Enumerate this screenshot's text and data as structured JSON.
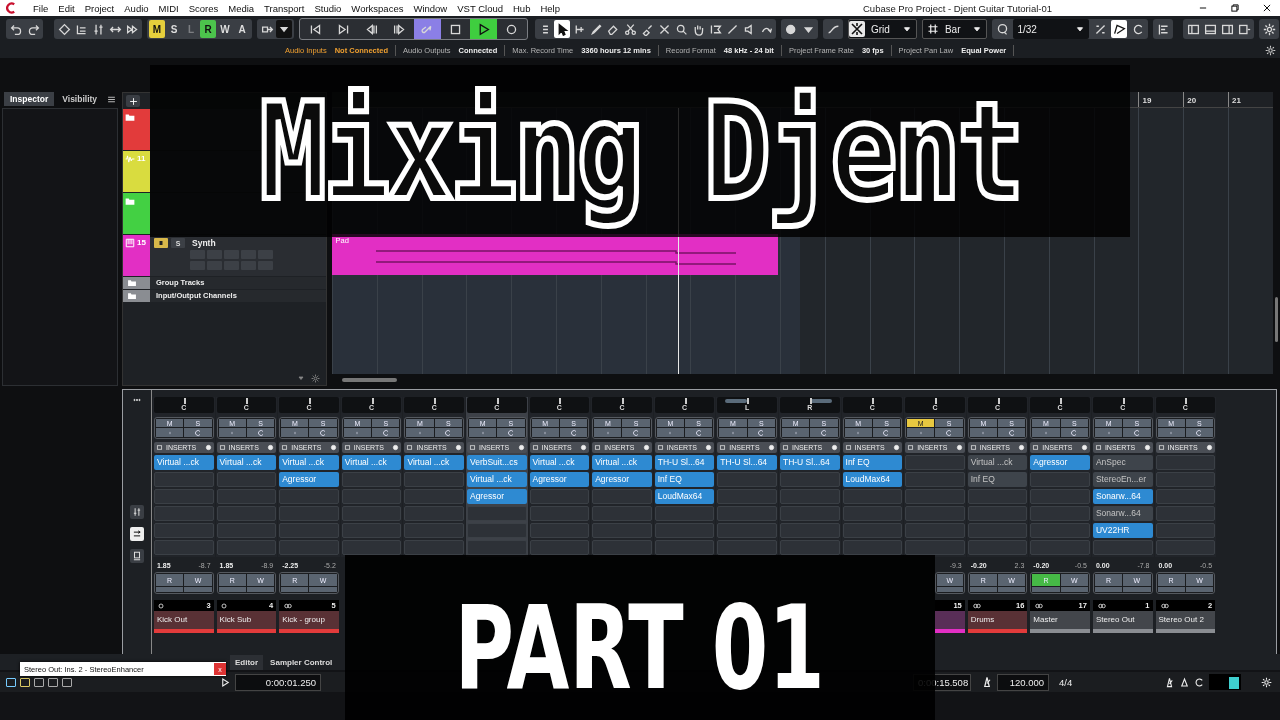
{
  "window": {
    "title": "Cubase Pro Project - Djent Guitar Tutorial-01"
  },
  "menu": [
    "File",
    "Edit",
    "Project",
    "Audio",
    "MIDI",
    "Scores",
    "Media",
    "Transport",
    "Studio",
    "Workspaces",
    "Window",
    "VST Cloud",
    "Hub",
    "Help"
  ],
  "toolbar": {
    "automation_modes": [
      {
        "label": "M",
        "on": true,
        "disabled": false,
        "color": "#e6cf3c"
      },
      {
        "label": "S",
        "on": false,
        "disabled": false
      },
      {
        "label": "L",
        "on": false,
        "disabled": true
      },
      {
        "label": "R",
        "on": true,
        "disabled": false,
        "color": "#4cc34c"
      },
      {
        "label": "W",
        "on": false,
        "disabled": false
      },
      {
        "label": "A",
        "on": false,
        "disabled": false
      }
    ],
    "cycle_on": true,
    "play_on": true,
    "snap_type": "Grid",
    "grid_type": "Bar",
    "quantize": "1/32"
  },
  "status_line": [
    {
      "label": "Audio Inputs",
      "value": "Not Connected",
      "warning": true
    },
    {
      "label": "Audio Outputs",
      "value": "Connected",
      "warning": false
    },
    {
      "label": "Max. Record Time",
      "value": "3360 hours 12 mins",
      "warning": false
    },
    {
      "label": "Record Format",
      "value": "48 kHz - 24 bit",
      "warning": false
    },
    {
      "label": "Project Frame Rate",
      "value": "30 fps",
      "warning": false
    },
    {
      "label": "Project Pan Law",
      "value": "Equal Power",
      "warning": false
    }
  ],
  "left_zone": {
    "tabs": [
      {
        "label": "Inspector",
        "selected": true
      },
      {
        "label": "Visibility",
        "selected": false
      }
    ]
  },
  "tracks": [
    {
      "kind": "folder",
      "color": "#e23b3b"
    },
    {
      "kind": "audio",
      "number": "11",
      "color": "#d9dc3f"
    },
    {
      "kind": "folder",
      "color": "#43d043"
    },
    {
      "kind": "instrument",
      "name": "Synth",
      "number": "15",
      "color": "#e22fc4",
      "mute_on": true,
      "solo_label": "S",
      "event": "Pad"
    },
    {
      "kind": "plain",
      "name": "Group Tracks"
    },
    {
      "kind": "plain",
      "name": "Input/Output Channels"
    }
  ],
  "ruler": [
    "19",
    "20",
    "21"
  ],
  "mixer": {
    "channels": [
      {
        "pan": {
          "label": "C",
          "kind": "center"
        },
        "mute": {
          "label": "M",
          "on": false
        },
        "solo": {
          "label": "S",
          "on": false
        },
        "inserts_label": "INSERTS",
        "inserts": [
          {
            "name": "Virtual ...ck",
            "active": true
          }
        ],
        "volume": "1.85",
        "peak": "-8.7",
        "read": {
          "label": "R",
          "on": false
        },
        "write": {
          "label": "W",
          "on": false
        },
        "number": "3",
        "stereo": false,
        "name": "Kick Out",
        "color": "#e23b3b",
        "selected": false
      },
      {
        "pan": {
          "label": "C",
          "kind": "center"
        },
        "mute": {
          "label": "M",
          "on": false
        },
        "solo": {
          "label": "S",
          "on": false
        },
        "inserts_label": "INSERTS",
        "inserts": [
          {
            "name": "Virtual ...ck",
            "active": true
          }
        ],
        "volume": "1.85",
        "peak": "-8.9",
        "read": {
          "label": "R",
          "on": false
        },
        "write": {
          "label": "W",
          "on": false
        },
        "number": "4",
        "stereo": false,
        "name": "Kick Sub",
        "color": "#e23b3b",
        "selected": false
      },
      {
        "pan": {
          "label": "C",
          "kind": "center"
        },
        "mute": {
          "label": "M",
          "on": false
        },
        "solo": {
          "label": "S",
          "on": false
        },
        "inserts_label": "INSERTS",
        "inserts": [
          {
            "name": "Virtual ...ck",
            "active": true
          },
          {
            "name": "Agressor",
            "active": true
          }
        ],
        "volume": "-2.25",
        "peak": "-5.2",
        "read": {
          "label": "R",
          "on": false
        },
        "write": {
          "label": "W",
          "on": false
        },
        "number": "5",
        "stereo": true,
        "name": "Kick - group",
        "color": "#e23b3b",
        "selected": false
      },
      {
        "pan": {
          "label": "C",
          "kind": "center"
        },
        "mute": {
          "label": "M",
          "on": false
        },
        "solo": {
          "label": "S",
          "on": false
        },
        "inserts_label": "INSERTS",
        "inserts": [
          {
            "name": "Virtual ...ck",
            "active": true
          }
        ],
        "selected": false
      },
      {
        "pan": {
          "label": "C",
          "kind": "center"
        },
        "mute": {
          "label": "M",
          "on": false
        },
        "solo": {
          "label": "S",
          "on": false
        },
        "inserts_label": "INSERTS",
        "inserts": [
          {
            "name": "Virtual ...ck",
            "active": true
          }
        ],
        "selected": false
      },
      {
        "pan": {
          "label": "C",
          "kind": "center"
        },
        "mute": {
          "label": "M",
          "on": false
        },
        "solo": {
          "label": "S",
          "on": false
        },
        "inserts_label": "INSERTS",
        "inserts": [
          {
            "name": "VerbSuit...cs",
            "active": true
          },
          {
            "name": "Virtual ...ck",
            "active": true
          },
          {
            "name": "Agressor",
            "active": true
          }
        ],
        "selected": true
      },
      {
        "pan": {
          "label": "C",
          "kind": "center"
        },
        "mute": {
          "label": "M",
          "on": false
        },
        "solo": {
          "label": "S",
          "on": false
        },
        "inserts_label": "INSERTS",
        "inserts": [
          {
            "name": "Virtual ...ck",
            "active": true
          },
          {
            "name": "Agressor",
            "active": true
          }
        ],
        "selected": false
      },
      {
        "pan": {
          "label": "C",
          "kind": "center"
        },
        "mute": {
          "label": "M",
          "on": false
        },
        "solo": {
          "label": "S",
          "on": false
        },
        "inserts_label": "INSERTS",
        "inserts": [
          {
            "name": "Virtual ...ck",
            "active": true
          },
          {
            "name": "Agressor",
            "active": true
          }
        ],
        "selected": false
      },
      {
        "pan": {
          "label": "C",
          "kind": "center"
        },
        "mute": {
          "label": "M",
          "on": false
        },
        "solo": {
          "label": "S",
          "on": false
        },
        "inserts_label": "INSERTS",
        "inserts": [
          {
            "name": "TH-U Sl...64",
            "active": true
          },
          {
            "name": "Inf EQ",
            "active": true
          },
          {
            "name": "LoudMax64",
            "active": true
          }
        ],
        "selected": false
      },
      {
        "pan": {
          "label": "L",
          "kind": "left"
        },
        "mute": {
          "label": "M",
          "on": false
        },
        "solo": {
          "label": "S",
          "on": false
        },
        "inserts_label": "INSERTS",
        "inserts": [
          {
            "name": "TH-U Sl...64",
            "active": true
          }
        ],
        "selected": false
      },
      {
        "pan": {
          "label": "R",
          "kind": "right"
        },
        "mute": {
          "label": "M",
          "on": false
        },
        "solo": {
          "label": "S",
          "on": false
        },
        "inserts_label": "INSERTS",
        "inserts": [
          {
            "name": "TH-U Sl...64",
            "active": true
          }
        ],
        "selected": false
      },
      {
        "pan": {
          "label": "C",
          "kind": "center"
        },
        "mute": {
          "label": "M",
          "on": false
        },
        "solo": {
          "label": "S",
          "on": false
        },
        "inserts_label": "INSERTS",
        "inserts": [
          {
            "name": "Inf EQ",
            "active": true
          },
          {
            "name": "LoudMax64",
            "active": true
          }
        ],
        "selected": false
      },
      {
        "pan": {
          "label": "C",
          "kind": "center"
        },
        "mute": {
          "label": "M",
          "on": true
        },
        "solo": {
          "label": "S",
          "on": false
        },
        "inserts_label": "INSERTS",
        "peak": "-9.3",
        "write": {
          "label": "W",
          "on": false
        },
        "number": "15",
        "color": "#e22fc4",
        "selected": false
      },
      {
        "pan": {
          "label": "C",
          "kind": "center"
        },
        "mute": {
          "label": "M",
          "on": false
        },
        "solo": {
          "label": "S",
          "on": false
        },
        "inserts_label": "INSERTS",
        "inserts": [
          {
            "name": "Virtual ...ck",
            "active": false
          },
          {
            "name": "Inf EQ",
            "active": false
          }
        ],
        "volume": "-0.20",
        "peak": "2.3",
        "read": {
          "label": "R",
          "on": false
        },
        "write": {
          "label": "W",
          "on": false
        },
        "number": "16",
        "stereo": true,
        "name": "Drums",
        "color": "#e23b3b",
        "selected": false
      },
      {
        "pan": {
          "label": "C",
          "kind": "center"
        },
        "mute": {
          "label": "M",
          "on": false
        },
        "solo": {
          "label": "S",
          "on": false
        },
        "inserts_label": "INSERTS",
        "inserts": [
          {
            "name": "Agressor",
            "active": true
          }
        ],
        "volume": "-0.20",
        "peak": "-0.5",
        "read": {
          "label": "R",
          "on": true
        },
        "write": {
          "label": "W",
          "on": false
        },
        "number": "17",
        "stereo": true,
        "name": "Master",
        "color": "#8a8d92",
        "selected": false
      },
      {
        "pan": {
          "label": "C",
          "kind": "center"
        },
        "mute": {
          "label": "M",
          "on": false
        },
        "solo": {
          "label": "S",
          "on": false
        },
        "inserts_label": "INSERTS",
        "inserts": [
          {
            "name": "AnSpec",
            "active": false
          },
          {
            "name": "StereoEn...er",
            "active": false
          },
          {
            "name": "Sonarw...64",
            "active": true
          },
          {
            "name": "Sonarw...64",
            "active": false
          },
          {
            "name": "UV22HR",
            "active": true
          }
        ],
        "volume": "0.00",
        "peak": "-7.8",
        "read": {
          "label": "R",
          "on": false
        },
        "write": {
          "label": "W",
          "on": false
        },
        "number": "1",
        "stereo": true,
        "name": "Stereo Out",
        "color": "#8a8d92",
        "selected": false
      },
      {
        "pan": {
          "label": "C",
          "kind": "center"
        },
        "mute": {
          "label": "M",
          "on": false
        },
        "solo": {
          "label": "S",
          "on": false
        },
        "inserts_label": "INSERTS",
        "volume": "0.00",
        "peak": "-0.5",
        "read": {
          "label": "R",
          "on": false
        },
        "write": {
          "label": "W",
          "on": false
        },
        "number": "2",
        "stereo": true,
        "name": "Stereo Out 2",
        "color": "#8a8d92",
        "selected": false
      }
    ]
  },
  "lower_zone": {
    "tabs": [
      {
        "label": "Editor",
        "selected": true
      },
      {
        "label": "Sampler Control",
        "selected": false
      }
    ],
    "tooltip": {
      "text": "Stereo Out: Ins. 2 - StereoEnhancer",
      "close": "x"
    }
  },
  "transport": {
    "left_locator": "0:00:01.250",
    "time": "0:00:15.508",
    "tempo": "120.000",
    "signature": "4/4"
  },
  "titles": {
    "main": "Mixing Djent",
    "part": "PART 01"
  }
}
